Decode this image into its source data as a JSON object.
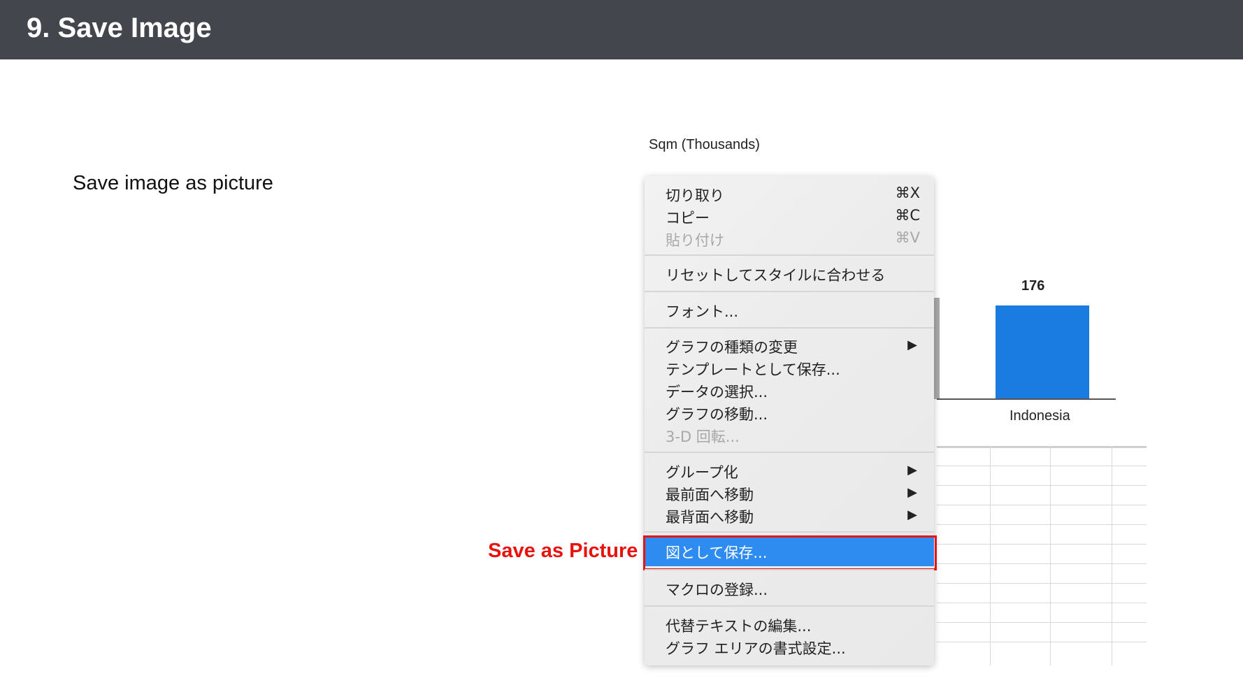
{
  "header": {
    "title": "9. Save Image"
  },
  "description": "Save image as picture",
  "callout": "Save as Picture",
  "chart": {
    "title": "Sqm (Thousands)",
    "bar_value": "176",
    "category": "Indonesia"
  },
  "chart_data": {
    "type": "bar",
    "title": "Sqm (Thousands)",
    "categories": [
      "Indonesia"
    ],
    "values": [
      176
    ]
  },
  "menu": {
    "items": [
      {
        "label": "切り取り",
        "shortcut": "⌘X"
      },
      {
        "label": "コピー",
        "shortcut": "⌘C"
      },
      {
        "label": "貼り付け",
        "shortcut": "⌘V"
      },
      {
        "label": "リセットしてスタイルに合わせる"
      },
      {
        "label": "フォント..."
      },
      {
        "label": "グラフの種類の変更",
        "arrow": "▶"
      },
      {
        "label": "テンプレートとして保存..."
      },
      {
        "label": "データの選択..."
      },
      {
        "label": "グラフの移動..."
      },
      {
        "label": "3-D 回転..."
      },
      {
        "label": "グループ化",
        "arrow": "▶"
      },
      {
        "label": "最前面へ移動",
        "arrow": "▶"
      },
      {
        "label": "最背面へ移動",
        "arrow": "▶"
      },
      {
        "label": "図として保存..."
      },
      {
        "label": "マクロの登録..."
      },
      {
        "label": "代替テキストの編集..."
      },
      {
        "label": "グラフ エリアの書式設定..."
      }
    ]
  },
  "colors": {
    "header_bg": "#43464d",
    "highlight": "#2e8cf0",
    "callout": "#e8130f",
    "bar": "#1a7be0"
  }
}
